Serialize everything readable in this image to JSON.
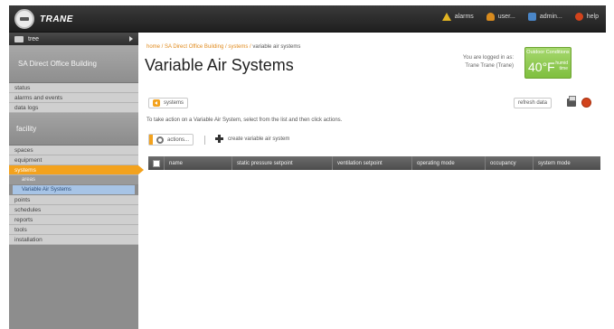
{
  "header": {
    "brand": "TRANE",
    "nav": [
      {
        "label": "alarms",
        "icon": "warning-icon"
      },
      {
        "label": "user...",
        "icon": "user-icon"
      },
      {
        "label": "admin...",
        "icon": "admin-icon"
      },
      {
        "label": "help",
        "icon": "help-icon"
      }
    ]
  },
  "sidebar": {
    "tree_label": "tree",
    "building": "SA Direct Office Building",
    "top_items": [
      "status",
      "alarms and events",
      "data logs"
    ],
    "facility_label": "facility",
    "facility_items": [
      "spaces",
      "equipment"
    ],
    "active_item": "systems",
    "sub_items": [
      "areas",
      "Variable Air Systems"
    ],
    "bottom_items": [
      "points",
      "schedules",
      "reports",
      "tools",
      "installation"
    ]
  },
  "main": {
    "breadcrumb": {
      "parts": [
        "home",
        "SA Direct Office Building",
        "systems"
      ],
      "current": "variable air systems"
    },
    "title": "Variable Air Systems",
    "logged_in": [
      "You are logged in as:",
      "Trane Trane (Trane)"
    ],
    "outdoor": {
      "label": "Outdoor Conditions",
      "temp": "40°F",
      "side": [
        "humid",
        "time"
      ]
    },
    "systems_button": "systems",
    "refresh_button": "refresh data",
    "instructions": "To take action on a Variable Air System, select from the list and then click actions.",
    "actions_button": "actions...",
    "create_link": "create variable air system",
    "table": {
      "columns": [
        "name",
        "static pressure setpoint",
        "ventilation setpoint",
        "operating mode",
        "occupancy",
        "system mode"
      ]
    }
  }
}
